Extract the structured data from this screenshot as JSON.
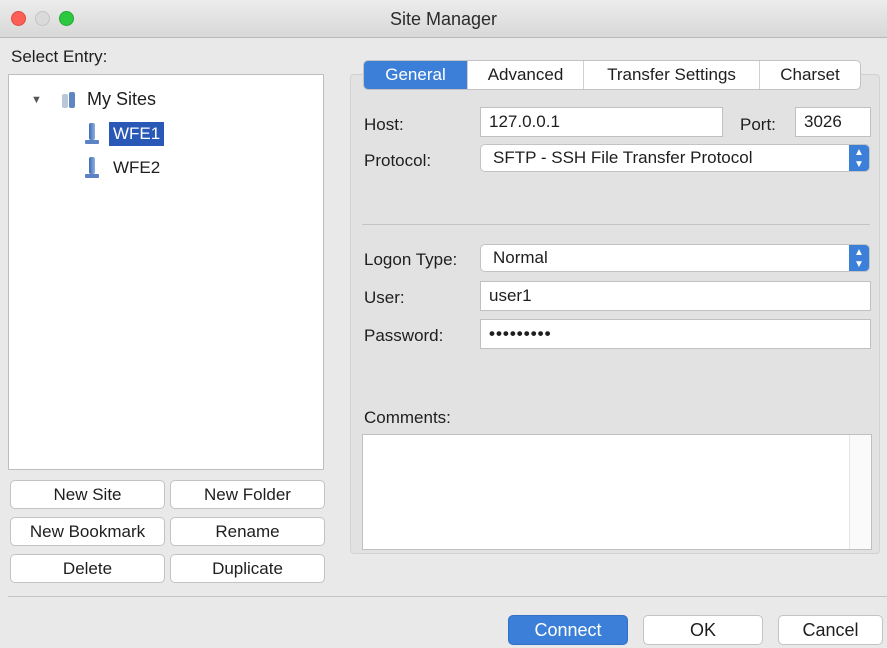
{
  "window": {
    "title": "Site Manager"
  },
  "tree": {
    "heading": "Select Entry:",
    "root_label": "My Sites",
    "sites": [
      {
        "label": "WFE1",
        "selected": true
      },
      {
        "label": "WFE2",
        "selected": false
      }
    ]
  },
  "left_buttons": {
    "new_site": "New Site",
    "new_folder": "New Folder",
    "new_bookmark": "New Bookmark",
    "rename": "Rename",
    "delete": "Delete",
    "duplicate": "Duplicate"
  },
  "tabs": [
    {
      "label": "General",
      "active": true
    },
    {
      "label": "Advanced",
      "active": false
    },
    {
      "label": "Transfer Settings",
      "active": false
    },
    {
      "label": "Charset",
      "active": false
    }
  ],
  "general": {
    "host_label": "Host:",
    "host_value": "127.0.0.1",
    "port_label": "Port:",
    "port_value": "3026",
    "protocol_label": "Protocol:",
    "protocol_value": "SFTP - SSH File Transfer Protocol",
    "logon_type_label": "Logon Type:",
    "logon_type_value": "Normal",
    "user_label": "User:",
    "user_value": "user1",
    "password_label": "Password:",
    "password_value": "•••••••••",
    "comments_label": "Comments:",
    "comments_value": ""
  },
  "footer": {
    "connect": "Connect",
    "ok": "OK",
    "cancel": "Cancel"
  },
  "colors": {
    "accent": "#3b7fd8",
    "selection": "#2a58b6"
  }
}
